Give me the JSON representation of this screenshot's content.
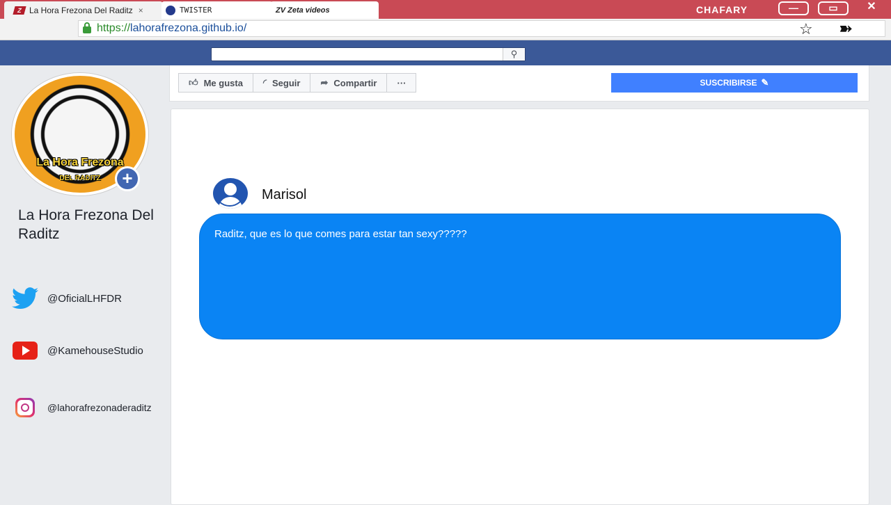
{
  "browser": {
    "tabs": [
      {
        "title": "La Hora Frezona Del Raditz",
        "close": "×",
        "active": true
      },
      {
        "title": "TWISTER",
        "active": false
      },
      {
        "title": "ZV Zeta videos",
        "active": false
      }
    ],
    "profile_name": "CHAFARY",
    "window_controls": {
      "minimize": "—",
      "maximize": "▭",
      "close": "✕"
    },
    "url_scheme": "https://",
    "url_host": "lahorafrezona.github.io/",
    "bookmark_icon": "star-icon",
    "extension_icon": "extension-icon"
  },
  "fb_bar": {
    "search_placeholder": "",
    "search_icon": "search-icon"
  },
  "sidebar": {
    "avatar_text": "La Hora Frezona",
    "avatar_subtext": "DEL RADITZ",
    "avatar_add": "+",
    "page_name": "La Hora Frezona Del Raditz",
    "socials": [
      {
        "icon": "twitter-icon",
        "handle": "@OficialLHFDR"
      },
      {
        "icon": "youtube-icon",
        "handle": "@KamehouseStudio"
      },
      {
        "icon": "instagram-icon",
        "handle": "@lahorafrezonaderaditz"
      }
    ]
  },
  "actions": {
    "like": "Me gusta",
    "follow": "Seguir",
    "share": "Compartir",
    "more": "···",
    "subscribe": "SUSCRIBIRSE"
  },
  "post": {
    "author": "Marisol",
    "message": "Raditz, que es lo que comes para estar tan sexy?????"
  },
  "colors": {
    "fb_blue": "#3b5998",
    "bubble_blue": "#0a84f4",
    "subscribe_blue": "#4080ff",
    "tabbar_red": "#c94a55"
  }
}
